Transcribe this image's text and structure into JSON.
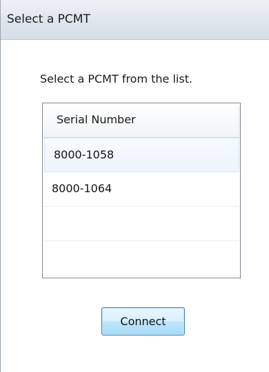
{
  "window": {
    "title": "Select a PCMT"
  },
  "dialog": {
    "prompt": "Select a PCMT from the list.",
    "list": {
      "column_header": "Serial Number",
      "rows": [
        {
          "serial": "8000-1058",
          "selected": true
        },
        {
          "serial": "8000-1064",
          "selected": false
        },
        {
          "serial": "",
          "selected": false
        },
        {
          "serial": "",
          "selected": false
        }
      ]
    },
    "connect_label": "Connect"
  },
  "colors": {
    "title_bar": "#dde5ed",
    "selection_highlight": "#edf4fc",
    "button_border": "#3c7fb1",
    "button_fill": "#bee6fd"
  }
}
